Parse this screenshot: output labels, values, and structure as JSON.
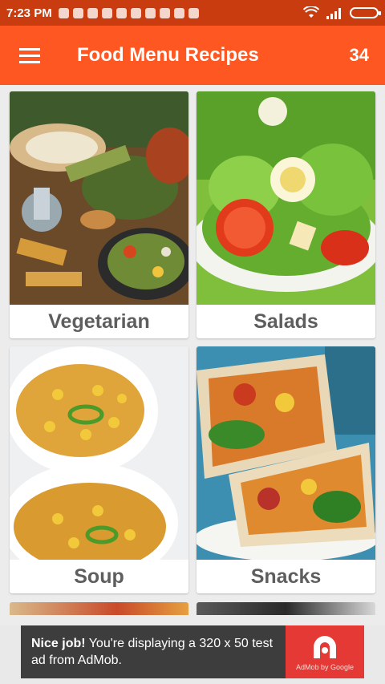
{
  "status_bar": {
    "time": "7:23 PM",
    "notification_icons": [
      "app-icon",
      "app-icon",
      "app-icon",
      "app-icon",
      "app-icon",
      "app-icon",
      "mail-icon",
      "app-icon",
      "app-icon",
      "app-icon"
    ],
    "wifi_icon": "wifi-icon",
    "signal_icon": "signal-icon",
    "battery_icon": "battery-icon"
  },
  "app_bar": {
    "menu_icon": "hamburger-menu-icon",
    "title": "Food Menu Recipes",
    "count": "34",
    "color": "#ff5722"
  },
  "categories": [
    {
      "label": "Vegetarian"
    },
    {
      "label": "Salads"
    },
    {
      "label": "Soup"
    },
    {
      "label": "Snacks"
    }
  ],
  "ad": {
    "headline": "Nice job!",
    "body": " You're displaying a 320 x 50 test ad from AdMob.",
    "logo_caption": "AdMob by Google"
  }
}
